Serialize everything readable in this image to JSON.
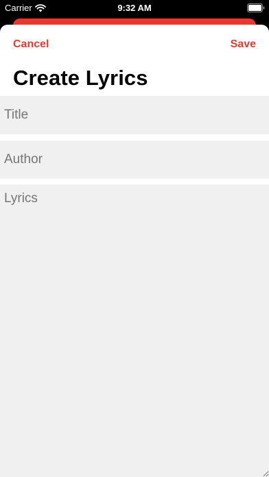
{
  "status_bar": {
    "carrier": "Carrier",
    "time": "9:32 AM",
    "icons": [
      "wifi-icon",
      "battery-icon"
    ]
  },
  "nav": {
    "cancel_label": "Cancel",
    "save_label": "Save"
  },
  "page": {
    "title": "Create Lyrics"
  },
  "form": {
    "title_placeholder": "Title",
    "author_placeholder": "Author",
    "lyrics_placeholder": "Lyrics"
  },
  "colors": {
    "accent": "#e8382f",
    "field_background": "#f0f0f0",
    "placeholder": "#8a8a8a"
  }
}
